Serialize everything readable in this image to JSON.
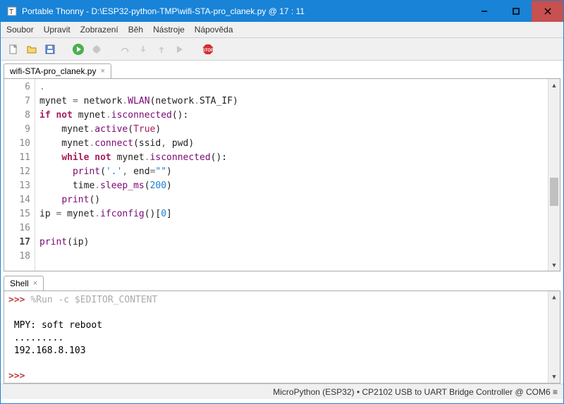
{
  "window": {
    "title": "Portable Thonny  -  D:\\ESP32-python-TMP\\wifi-STA-pro_clanek.py  @  17 : 11"
  },
  "menu": {
    "file": "Soubor",
    "edit": "Upravit",
    "view": "Zobrazení",
    "run": "Běh",
    "tools": "Nástroje",
    "help": "Nápověda"
  },
  "tab": {
    "name": "wifi-STA-pro_clanek.py"
  },
  "gutter": {
    "lines": [
      "6",
      "7",
      "8",
      "9",
      "10",
      "11",
      "12",
      "13",
      "14",
      "15",
      "16",
      "17",
      "18"
    ],
    "current": "17"
  },
  "code": {
    "l6": ".",
    "l7a": "mynet ",
    "l7b": "=",
    "l7c": " network",
    "l7d": ".",
    "l7e": "WLAN",
    "l7f": "(network",
    "l7g": ".",
    "l7h": "STA_IF)",
    "l8a": "if",
    "l8b": " ",
    "l8c": "not",
    "l8d": " mynet",
    "l8e": ".",
    "l8f": "isconnected",
    "l8g": "():",
    "l9a": "    mynet",
    "l9b": ".",
    "l9c": "active",
    "l9d": "(",
    "l9e": "True",
    "l9f": ")",
    "l10a": "    mynet",
    "l10b": ".",
    "l10c": "connect",
    "l10d": "(ssid",
    "l10e": ",",
    "l10f": " pwd)",
    "l11a": "    ",
    "l11b": "while",
    "l11c": " ",
    "l11d": "not",
    "l11e": " mynet",
    "l11f": ".",
    "l11g": "isconnected",
    "l11h": "():",
    "l12a": "      ",
    "l12b": "print",
    "l12c": "(",
    "l12d": "'.'",
    "l12e": ",",
    "l12f": " end",
    "l12g": "=",
    "l12h": "\"\"",
    "l12i": ")",
    "l13a": "      time",
    "l13b": ".",
    "l13c": "sleep_ms",
    "l13d": "(",
    "l13e": "200",
    "l13f": ")",
    "l14a": "    ",
    "l14b": "print",
    "l14c": "()",
    "l15a": "ip ",
    "l15b": "=",
    "l15c": " mynet",
    "l15d": ".",
    "l15e": "ifconfig",
    "l15f": "()[",
    "l15g": "0",
    "l15h": "]",
    "l17a": "print",
    "l17b": "(ip)"
  },
  "shell": {
    "label": "Shell",
    "prompt1": ">>> ",
    "cmd": "%Run -c $EDITOR_CONTENT",
    "out1": "MPY: soft reboot",
    "out2": ".........",
    "out3": "192.168.8.103",
    "prompt2": ">>> "
  },
  "status": {
    "text": "MicroPython (ESP32)  •  CP2102 USB to UART Bridge Controller @ COM6 ≡"
  }
}
